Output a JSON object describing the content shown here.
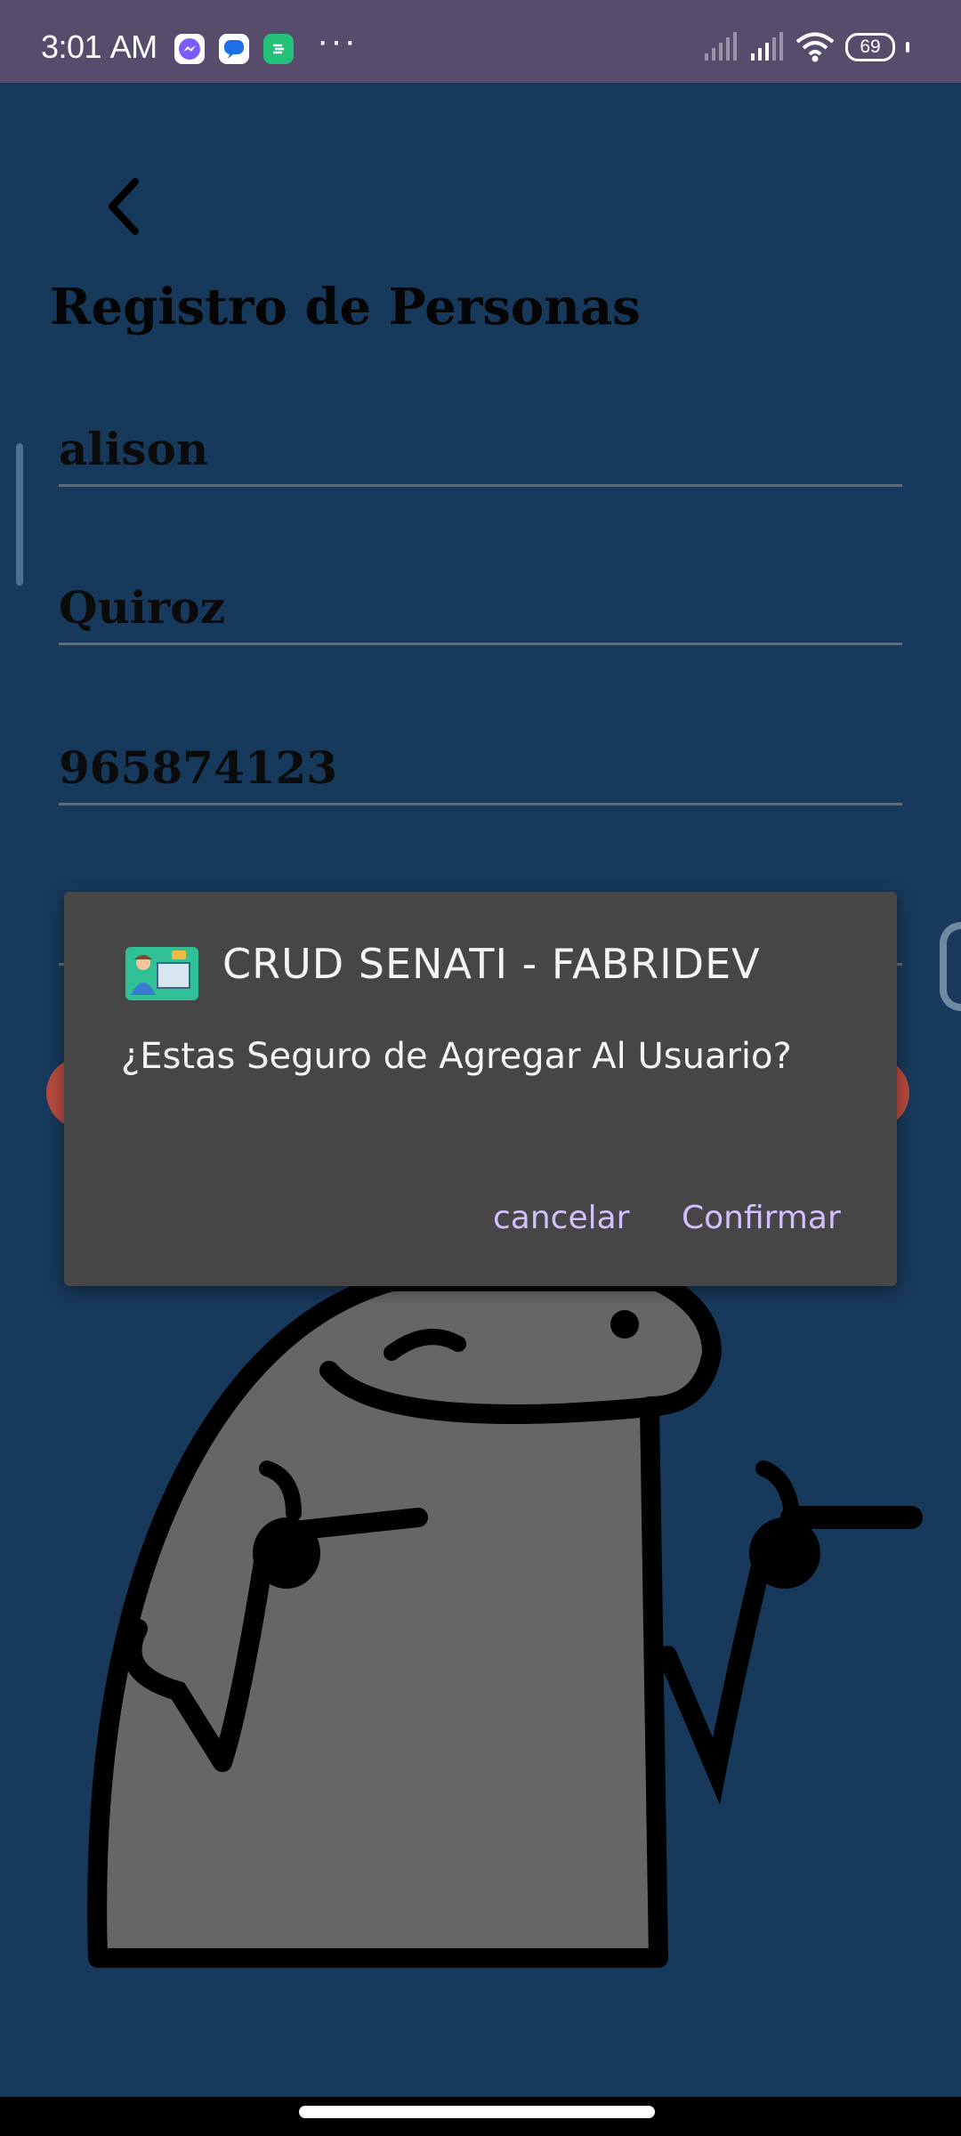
{
  "status_bar": {
    "time": "3:01",
    "ampm": "AM",
    "more": "···",
    "battery": "69",
    "icons": [
      "messenger-icon",
      "chat-icon",
      "app-icon",
      "signal-icon",
      "signal-icon",
      "wifi-icon",
      "battery-icon"
    ]
  },
  "page": {
    "back_icon": "chevron-left-icon",
    "title": "Registro de Personas",
    "fields": [
      {
        "value": "alison"
      },
      {
        "value": "Quiroz"
      },
      {
        "value": "965874123"
      }
    ]
  },
  "dialog": {
    "title": "CRUD SENATI - FABRIDEV",
    "message": "¿Estas Seguro de Agregar Al Usuario?",
    "cancel_label": "cancelar",
    "confirm_label": "Confirmar"
  },
  "colors": {
    "background": "#17395b",
    "status_bar": "#574c6b",
    "dialog": "#464646",
    "accent": "#d3bfff"
  }
}
